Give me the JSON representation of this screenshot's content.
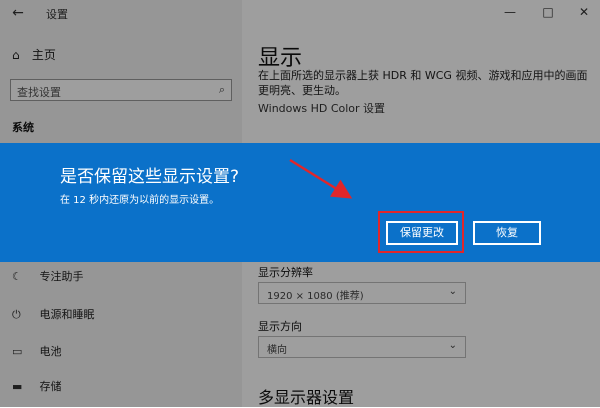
{
  "window": {
    "title": "设置",
    "controls": [
      "—",
      "□",
      "✕"
    ]
  },
  "sidebar": {
    "home": "主页",
    "search_placeholder": "查找设置",
    "section": "系统",
    "items": [
      {
        "label": "专注助手",
        "icon": "moon-icon"
      },
      {
        "label": "电源和睡眠",
        "icon": "power-icon"
      },
      {
        "label": "电池",
        "icon": "battery-icon"
      },
      {
        "label": "存储",
        "icon": "storage-icon"
      }
    ]
  },
  "main": {
    "title": "显示",
    "hdr_text": "在上面所选的显示器上获 HDR 和 WCG 视频、游戏和应用中的画面更明亮、更生动。",
    "hdr_link": "Windows HD Color 设置",
    "resolution_label": "显示分辨率",
    "resolution_value": "1920 × 1080 (推荐)",
    "orientation_label": "显示方向",
    "orientation_value": "横向",
    "multi_display": "多显示器设置"
  },
  "dialog": {
    "title": "是否保留这些显示设置?",
    "message": "在 12 秒内还原为以前的显示设置。",
    "keep_button": "保留更改",
    "revert_button": "恢复"
  },
  "annotation": {
    "highlight_color": "#e0262b",
    "arrow_color": "#e0262b"
  },
  "colors": {
    "dialog_bg": "#0b71c9"
  }
}
